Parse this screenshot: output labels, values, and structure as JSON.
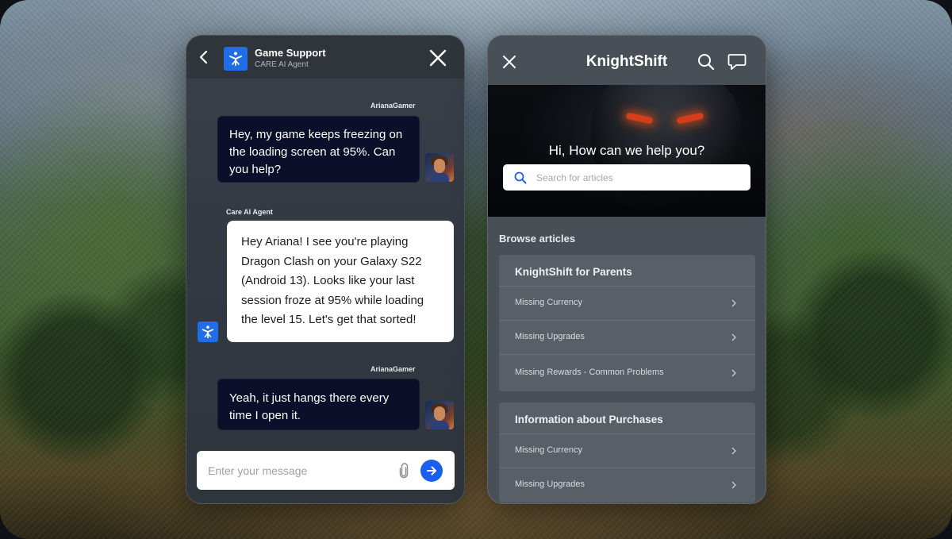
{
  "chat": {
    "title": "Game Support",
    "subtitle": "CARE AI Agent",
    "messages": [
      {
        "sender": "ArianaGamer",
        "text": "Hey, my game keeps freezing on the loading screen at 95%. Can you help?"
      },
      {
        "sender": "Care AI Agent",
        "text": "Hey Ariana! I see you're playing Dragon Clash on your Galaxy S22 (Android 13). Looks like your last session froze at 95% while loading the level 15. Let's get that sorted!"
      },
      {
        "sender": "ArianaGamer",
        "text": "Yeah, it just hangs there every time I open it."
      }
    ],
    "composer": {
      "placeholder": "Enter your message"
    },
    "icons": [
      "chevron-left-icon",
      "care-logo-icon",
      "close-icon",
      "paperclip-icon",
      "arrow-right-icon"
    ],
    "colors": {
      "accent": "#1a5ff0",
      "logo": "#1f6ee6",
      "user_bubble": "#0c0f2a",
      "bot_bubble": "#ffffff"
    }
  },
  "help": {
    "title": "KnightShift",
    "greeting": "Hi, How can we help you?",
    "search": {
      "placeholder": "Search for articles"
    },
    "browse_label": "Browse articles",
    "sections": [
      {
        "title": "KnightShift for Parents",
        "articles": [
          "Missing Currency",
          "Missing Upgrades",
          "Missing Rewards - Common Problems"
        ]
      },
      {
        "title": "Information about Purchases",
        "articles": [
          "Missing Currency",
          "Missing Upgrades"
        ]
      }
    ],
    "icons": [
      "close-icon",
      "search-icon",
      "chat-bubble-icon",
      "chevron-right-icon"
    ],
    "colors": {
      "panel": "#494f57",
      "section": "#595f67",
      "eye_glow": "#ff4b1f"
    }
  }
}
